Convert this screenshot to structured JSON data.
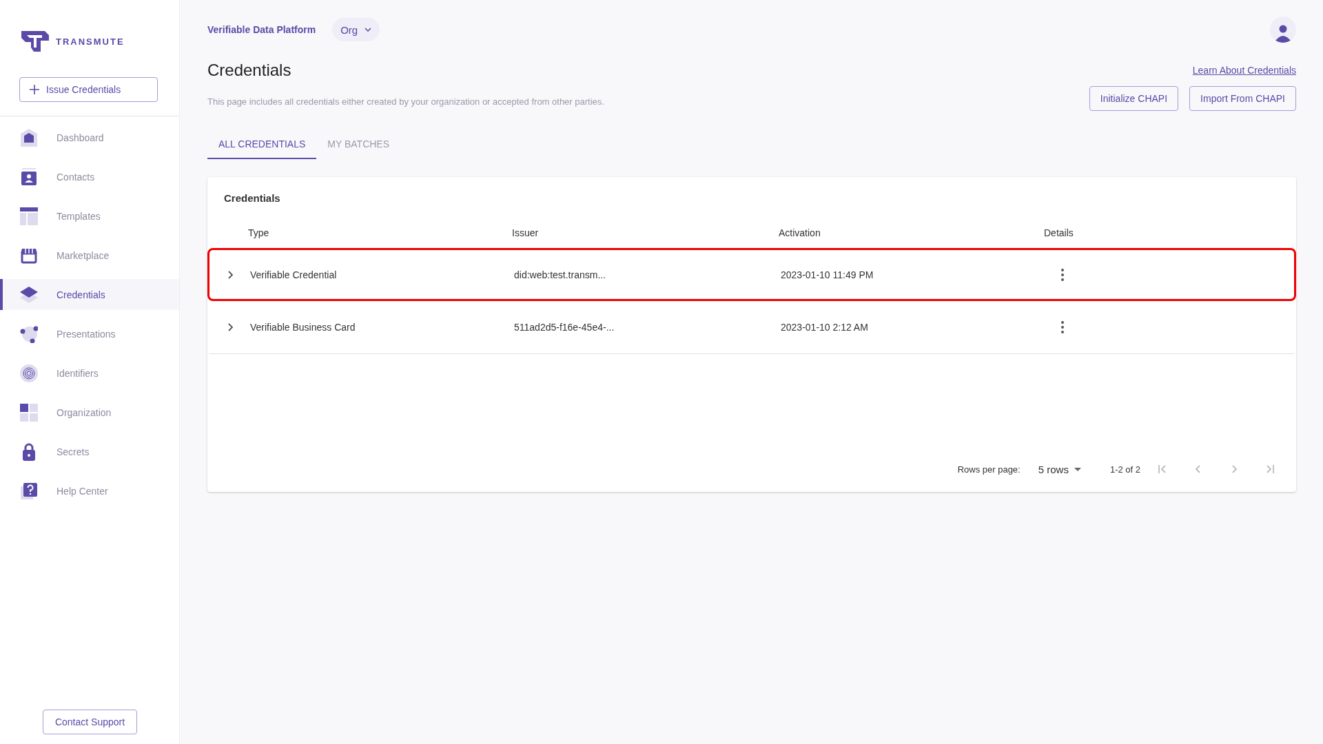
{
  "brand": {
    "name": "TRANSMUTE"
  },
  "sidebar": {
    "action": "Issue Credentials",
    "items": [
      {
        "label": "Dashboard",
        "selected": false
      },
      {
        "label": "Contacts",
        "selected": false
      },
      {
        "label": "Templates",
        "selected": false
      },
      {
        "label": "Marketplace",
        "selected": false
      },
      {
        "label": "Credentials",
        "selected": true
      },
      {
        "label": "Presentations",
        "selected": false
      },
      {
        "label": "Identifiers",
        "selected": false
      },
      {
        "label": "Organization",
        "selected": false
      },
      {
        "label": "Secrets",
        "selected": false
      },
      {
        "label": "Help Center",
        "selected": false
      }
    ],
    "support": "Contact Support"
  },
  "topbar": {
    "platform": "Verifiable Data Platform",
    "org": "Org"
  },
  "page": {
    "title": "Credentials",
    "description": "This page includes all credentials either created by your organization or accepted from other parties.",
    "link": "Learn About Credentials",
    "buttons": [
      "Initialize CHAPI",
      "Import From CHAPI"
    ]
  },
  "tabs": [
    {
      "label": "ALL CREDENTIALS",
      "selected": true
    },
    {
      "label": "MY BATCHES",
      "selected": false
    }
  ],
  "table": {
    "title": "Credentials",
    "columns": [
      "Type",
      "Issuer",
      "Activation",
      "Details"
    ],
    "rows": [
      {
        "type": "Verifiable Credential",
        "issuer": "did:web:test.transm...",
        "activation": "2023-01-10 11:49 PM",
        "highlighted": true
      },
      {
        "type": "Verifiable Business Card",
        "issuer": "511ad2d5-f16e-45e4-...",
        "activation": "2023-01-10 2:12 AM",
        "highlighted": false
      }
    ]
  },
  "pagination": {
    "rows_label": "Rows per page:",
    "rows_value": "5 rows",
    "range": "1-2 of 2",
    "first_disabled": true,
    "prev_disabled": true,
    "next_disabled": true,
    "last_disabled": true
  }
}
